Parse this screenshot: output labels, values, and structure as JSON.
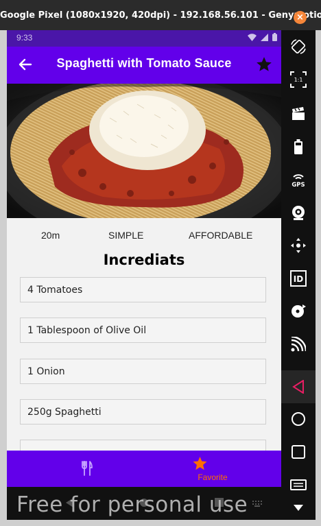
{
  "window": {
    "title": "Google Pixel (1080x1920, 420dpi) - 192.168.56.101 - Genymotion",
    "close_label": "×"
  },
  "statusbar": {
    "time": "9:33"
  },
  "appbar": {
    "title": "Spaghetti with Tomato Sauce"
  },
  "meal": {
    "duration": "20m",
    "complexity": "SIMPLE",
    "affordability": "AFFORDABLE"
  },
  "ingredients": {
    "heading": "Incrediats",
    "items": [
      "4 Tomatoes",
      "1 Tablespoon of Olive Oil",
      "1 Onion",
      "250g Spaghetti"
    ]
  },
  "bottom_nav": {
    "tabs": [
      {
        "label": "",
        "icon": "restaurant-icon",
        "active": false
      },
      {
        "label": "Favorite",
        "icon": "star-icon",
        "active": true
      }
    ]
  },
  "toolbar": {
    "items": [
      "rotate-icon",
      "pixel-perfect-icon",
      "capture-icon",
      "battery-icon",
      "gps-icon",
      "camera-icon",
      "navigation-icon",
      "device-id-icon",
      "disk-icon",
      "cast-icon"
    ],
    "gps_label": "GPS",
    "id_label": "ID",
    "ratio_label": "1:1"
  },
  "watermark": "Free for personal use",
  "colors": {
    "primary": "#6200ea",
    "status_bar": "#4a16a8",
    "accent": "#ff6d00",
    "back_nav_accent": "#e91e63"
  }
}
